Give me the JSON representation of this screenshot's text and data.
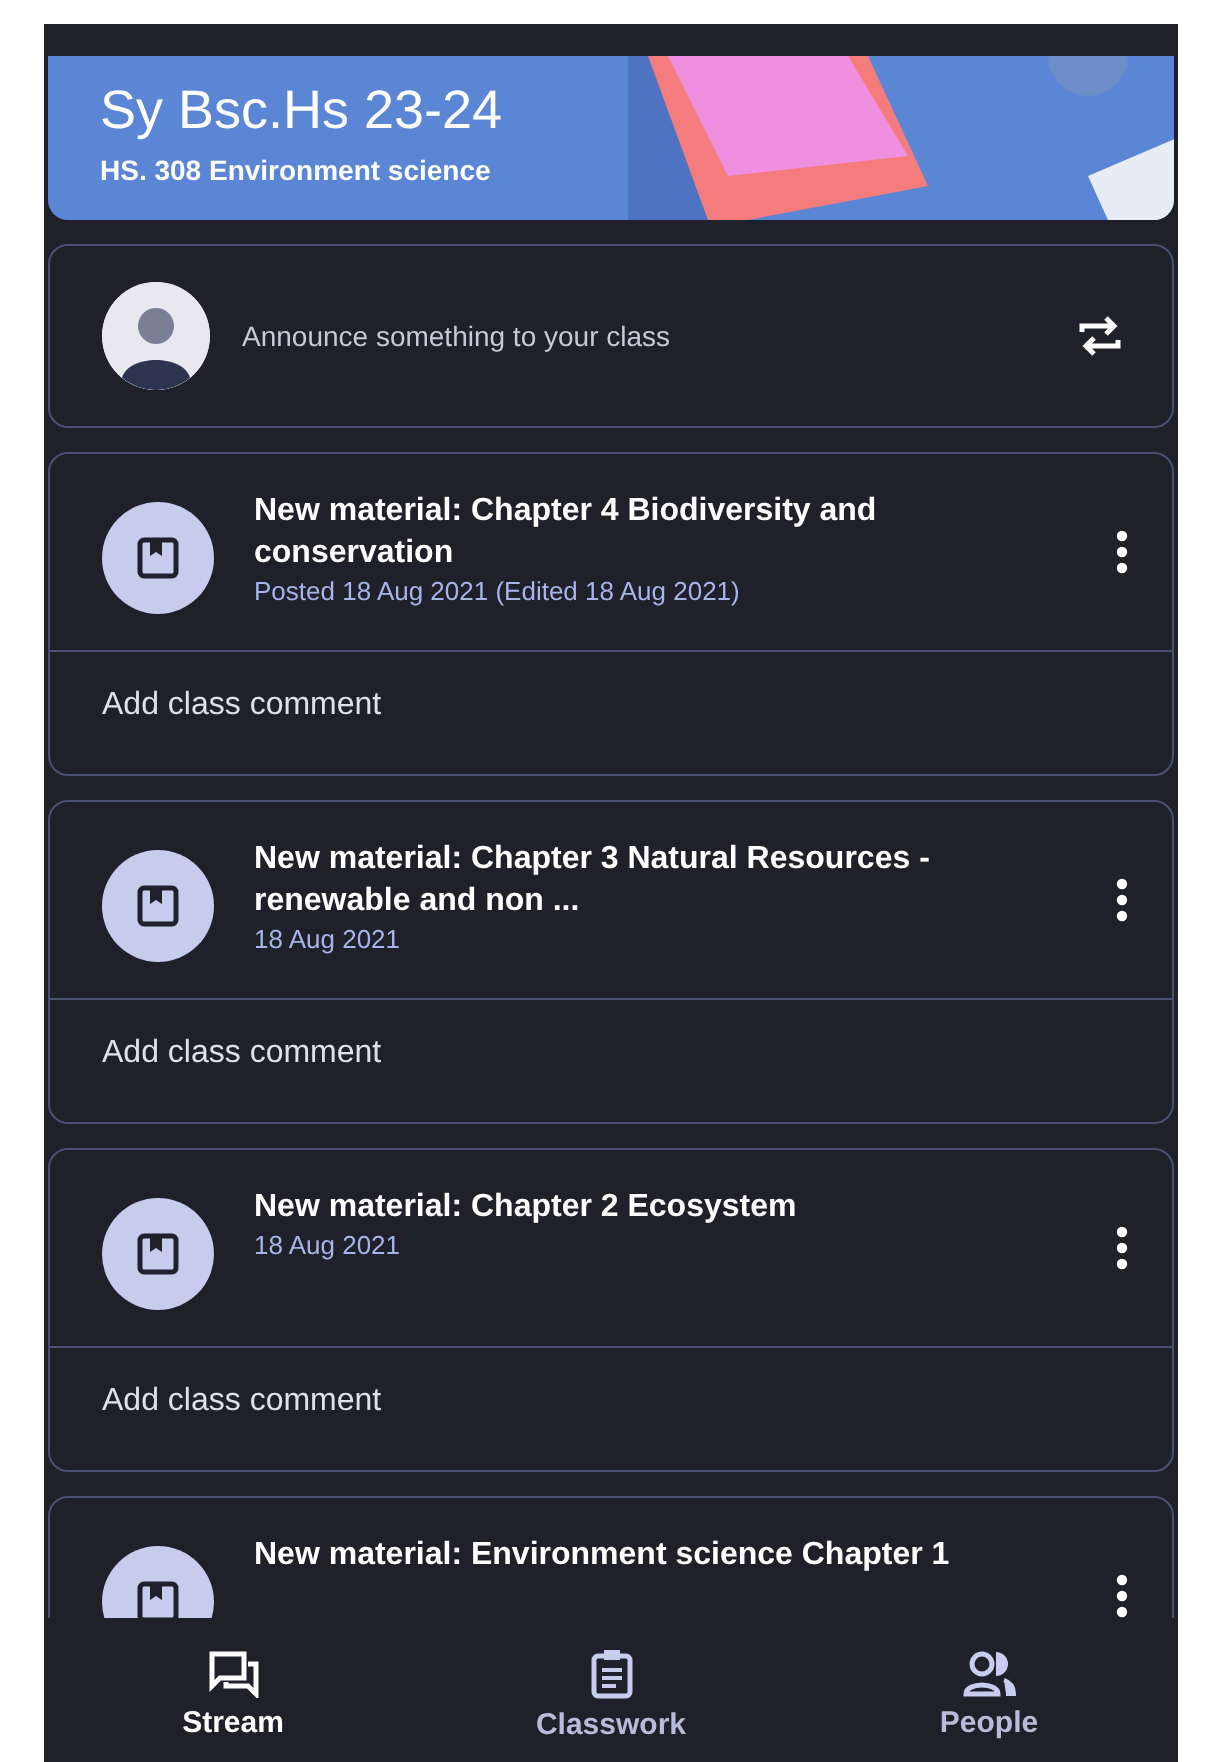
{
  "banner": {
    "title": "Sy Bsc.Hs 23-24",
    "subtitle": "HS. 308 Environment science"
  },
  "announce": {
    "placeholder": "Announce something to your class"
  },
  "posts": [
    {
      "title": "New material: Chapter 4 Biodiversity and conservation",
      "date": "Posted 18 Aug 2021 (Edited 18 Aug 2021)",
      "comment": "Add class comment"
    },
    {
      "title": "New material: Chapter 3 Natural Resources - renewable and non ...",
      "date": "18 Aug 2021",
      "comment": "Add class comment"
    },
    {
      "title": "New material: Chapter 2 Ecosystem",
      "date": "18 Aug 2021",
      "comment": "Add class comment"
    },
    {
      "title": "New material: Environment science Chapter 1"
    }
  ],
  "nav": [
    {
      "label": "Stream",
      "kind": "stream",
      "selected": true
    },
    {
      "label": "Classwork",
      "kind": "classwork",
      "selected": false
    },
    {
      "label": "People",
      "kind": "people",
      "selected": false
    }
  ]
}
